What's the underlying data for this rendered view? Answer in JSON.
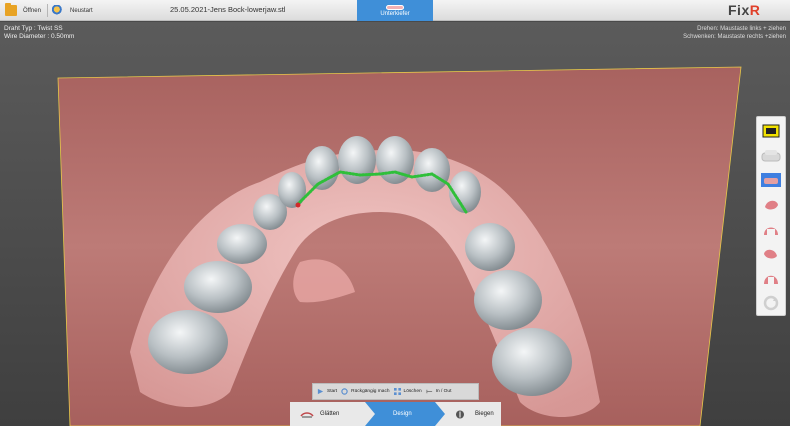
{
  "toolbar": {
    "open_label": "Öffnen",
    "restart_label": "Neustart",
    "file_title": "25.05.2021-Jens Bock-lowerjaw.stl",
    "jaw_tab_label": "Unterkiefer",
    "logo_text": "Fix",
    "logo_accent": "R"
  },
  "info": {
    "wire_type": "Draht Typ : Twist SS",
    "wire_diameter": "Wire Diameter : 0.50mm",
    "rotate_hint": "Drehen: Maustaste links + ziehen",
    "pan_hint": "Schwenken: Maustaste rechts +ziehen"
  },
  "edit_tools": {
    "start": "Start",
    "undo": "Rückgängig mach",
    "delete": "Löschen",
    "in_out": "In / Out"
  },
  "steps": {
    "smooth": "Glätten",
    "design": "Design",
    "bend": "Biegen"
  },
  "palette": {
    "items": [
      "view-front-icon",
      "upper-jaw-icon",
      "lower-jaw-icon",
      "view-left-icon",
      "view-front-jaw-icon",
      "view-right-icon",
      "view-back-jaw-icon",
      "reset-view-icon"
    ]
  },
  "colors": {
    "accent": "#3f8fd8",
    "plate": "#b7726f",
    "wire": "#2fbf3a"
  }
}
